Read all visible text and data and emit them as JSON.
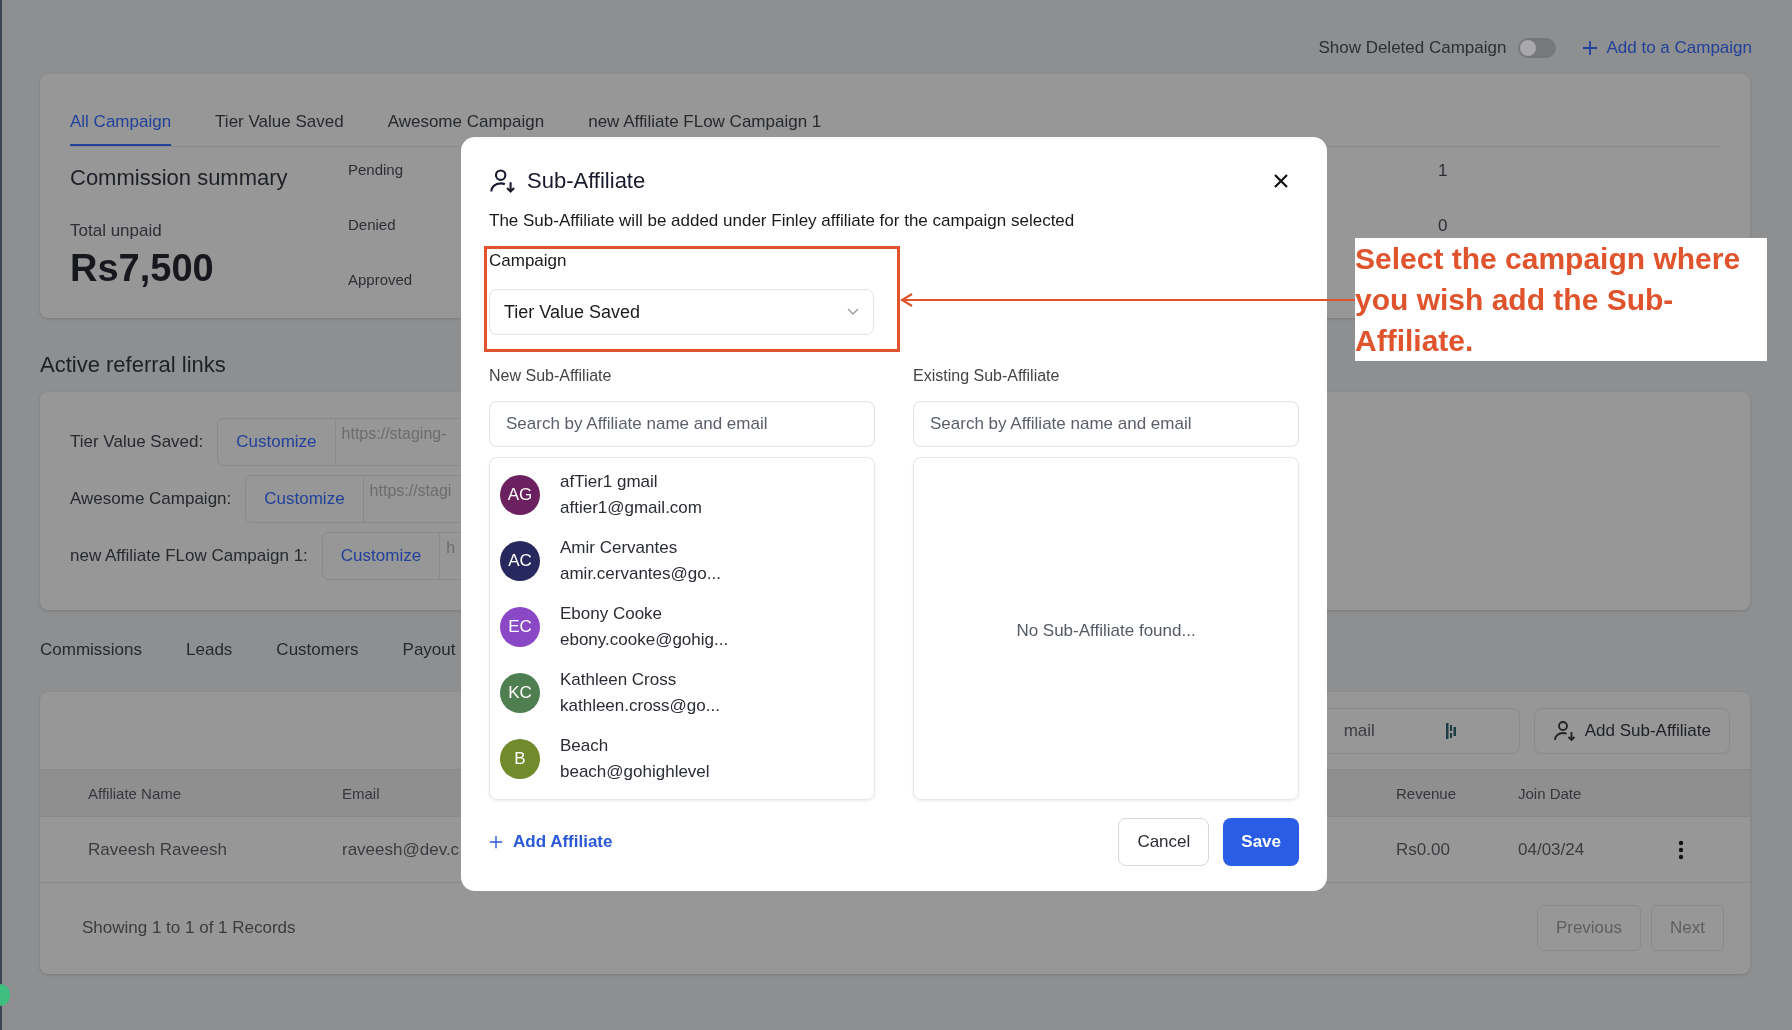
{
  "header": {
    "toggle": {
      "label": "Show Deleted Campaign",
      "on": false
    },
    "add_link": "Add to a Campaign"
  },
  "campaign_tabs": [
    {
      "label": "All Campaign",
      "selected": true
    },
    {
      "label": "Tier Value Saved",
      "selected": false
    },
    {
      "label": "Awesome Campaign",
      "selected": false
    },
    {
      "label": "new Affiliate FLow Campaign 1",
      "selected": false
    }
  ],
  "commission_summary": {
    "title": "Commission summary",
    "total_label": "Total unpaid",
    "total_value": "Rs7,500",
    "statuses": [
      {
        "label": "Pending",
        "value": "1"
      },
      {
        "label": "Denied",
        "value": "0"
      },
      {
        "label": "Approved"
      }
    ]
  },
  "referral_links": {
    "title": "Active referral links",
    "links": [
      {
        "campaign": "Tier Value Saved:",
        "button": "Customize",
        "url": "https://staging-"
      },
      {
        "campaign": "Awesome Campaign:",
        "button": "Customize",
        "url": "https://stagi"
      },
      {
        "campaign": "new Affiliate FLow Campaign 1:",
        "button": "Customize",
        "url": "h"
      }
    ]
  },
  "section_tabs": [
    {
      "label": "Commissions"
    },
    {
      "label": "Leads"
    },
    {
      "label": "Customers"
    },
    {
      "label": "Payout"
    }
  ],
  "affiliates_table": {
    "search_value": "mail",
    "add_button": "Add Sub-Affiliate",
    "columns": [
      "Affiliate Name",
      "Email",
      "Revenue",
      "Join Date"
    ],
    "rows": [
      {
        "cells": [
          "Raveesh Raveesh",
          "raveesh@dev.c",
          "Rs0.00",
          "04/03/24"
        ]
      }
    ],
    "footer": "Showing 1 to 1 of 1 Records",
    "pagination": [
      "Previous",
      "Next"
    ]
  },
  "modal": {
    "title": "Sub-Affiliate",
    "description": "The Sub-Affiliate will be added under Finley affiliate for the campaign selected",
    "campaign_label": "Campaign",
    "campaign_value": "Tier Value Saved",
    "new_panel": {
      "label": "New Sub-Affiliate",
      "placeholder": "Search by Affiliate name and email",
      "affiliates": [
        {
          "initials": "AG",
          "name": "afTier1 gmail",
          "email": "aftier1@gmail.com",
          "color": "#6b2160"
        },
        {
          "initials": "AC",
          "name": "Amir Cervantes",
          "email": "amir.cervantes@go...",
          "color": "#27295e"
        },
        {
          "initials": "EC",
          "name": "Ebony Cooke",
          "email": "ebony.cooke@gohig...",
          "color": "#8a47c6"
        },
        {
          "initials": "KC",
          "name": "Kathleen Cross",
          "email": "kathleen.cross@go...",
          "color": "#4f7f51"
        },
        {
          "initials": "B",
          "name": "Beach",
          "email": "beach@gohighlevel",
          "color": "#708a2c"
        }
      ]
    },
    "existing_panel": {
      "label": "Existing Sub-Affiliate",
      "placeholder": "Search by Affiliate name and email",
      "empty_text": "No Sub-Affiliate found..."
    },
    "add_affiliate": "Add Affiliate",
    "buttons": [
      "Cancel",
      "Save"
    ]
  },
  "annotation": {
    "text": "Select the campaign where you wish add the Sub-Affiliate."
  }
}
